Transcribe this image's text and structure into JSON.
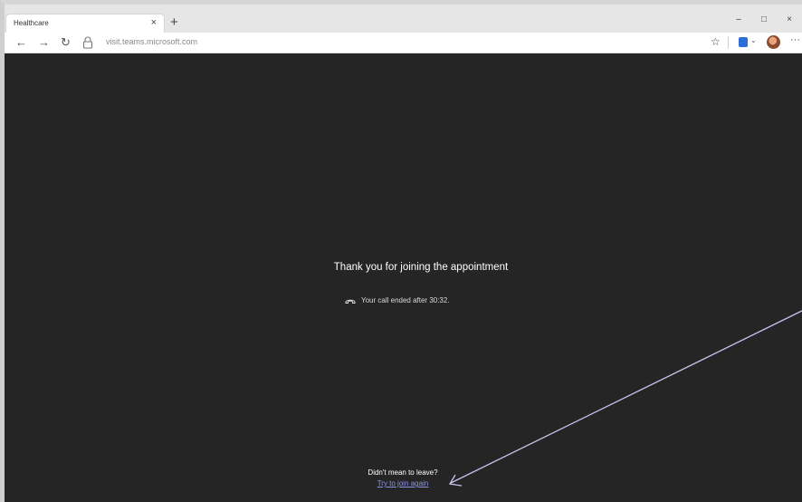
{
  "browser": {
    "tab_title": "Healthcare",
    "tab_close": "×",
    "new_tab": "+",
    "window_controls": [
      "–",
      "□",
      "×"
    ],
    "address": "visit.teams.microsoft.com",
    "icons": {
      "back": "←",
      "forward": "→",
      "refresh": "↻",
      "favorite": "☆",
      "more": "···",
      "dropdown": "⌄"
    }
  },
  "page": {
    "heading": "Thank you for joining the appointment",
    "call_status": "Your call ended after 30:32.",
    "leave_question": "Didn't mean to leave?",
    "rejoin_link": "Try to join again"
  },
  "colors": {
    "content_bg": "#262525",
    "link": "#8e94e8",
    "annotation_arrow": "#c9c3f0"
  }
}
